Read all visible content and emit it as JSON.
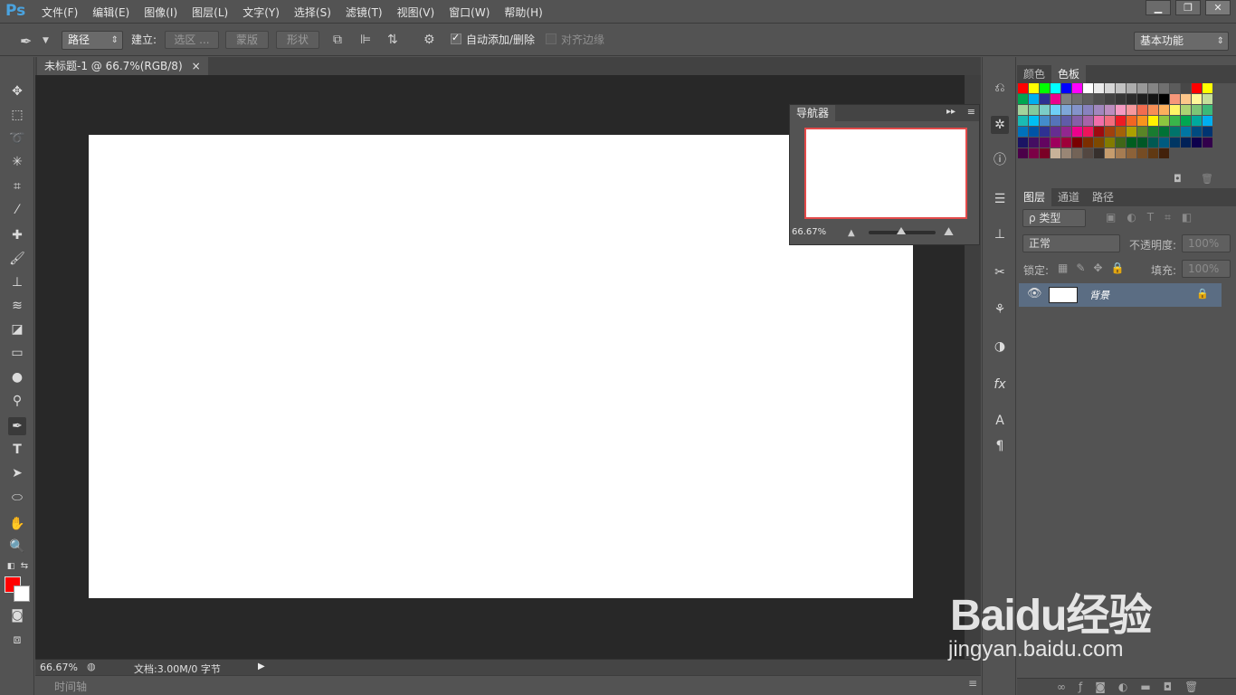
{
  "app": {
    "logo": "Ps"
  },
  "menu": [
    "文件(F)",
    "编辑(E)",
    "图像(I)",
    "图层(L)",
    "文字(Y)",
    "选择(S)",
    "滤镜(T)",
    "视图(V)",
    "窗口(W)",
    "帮助(H)"
  ],
  "window_controls": {
    "minimize": "▁",
    "restore": "❐",
    "close": "✕"
  },
  "options": {
    "mode_select": "路径",
    "make_label": "建立:",
    "selection_btn": "选区 ...",
    "mask_btn": "蒙版",
    "shape_btn": "形状",
    "auto_add_delete": "自动添加/删除",
    "align_edges": "对齐边缘",
    "workspace": "基本功能"
  },
  "document": {
    "tab_title": "未标题-1 @ 66.7%(RGB/8)",
    "tab_close": "×"
  },
  "navigator": {
    "tab": "导航器",
    "zoom": "66.67%"
  },
  "swatch_panel": {
    "tabs": [
      "颜色",
      "色板"
    ]
  },
  "swatch_colors": [
    "#ff0000",
    "#ffff00",
    "#00ff00",
    "#00ffff",
    "#0000ff",
    "#ff00ff",
    "#ffffff",
    "#ebebeb",
    "#d6d6d6",
    "#c2c2c2",
    "#adadad",
    "#999999",
    "#858585",
    "#707070",
    "#5c5c5c",
    "#474747",
    "#ff0000",
    "#ffff00",
    "#00a651",
    "#00aeef",
    "#2e3192",
    "#ec008c",
    "#808080",
    "#6e6e6e",
    "#5e5e5e",
    "#4f4f4f",
    "#424242",
    "#363636",
    "#2b2b2b",
    "#1f1f1f",
    "#141414",
    "#000000",
    "#f7977a",
    "#fdc68a",
    "#fff79a",
    "#c4df9b",
    "#a3d39c",
    "#82ca9d",
    "#7bcdc8",
    "#6ecff6",
    "#7ea7d8",
    "#8493ca",
    "#8882be",
    "#a187be",
    "#bc8dbf",
    "#f49ac2",
    "#f6989d",
    "#f26c4f",
    "#f68e55",
    "#fbaf5c",
    "#fff467",
    "#acd373",
    "#7cc576",
    "#3bb878",
    "#1abbb4",
    "#00bff3",
    "#438ccb",
    "#5574b9",
    "#605ca8",
    "#855fa8",
    "#a763a8",
    "#f06ea9",
    "#f26d7d",
    "#ed1c24",
    "#f26522",
    "#f7941d",
    "#fff200",
    "#8dc63f",
    "#39b54a",
    "#00a651",
    "#00a99d",
    "#00aeef",
    "#0072bc",
    "#0054a6",
    "#2e3192",
    "#662d91",
    "#92278f",
    "#ec008c",
    "#ed145b",
    "#9e0b0f",
    "#a0410d",
    "#a36209",
    "#aba000",
    "#598527",
    "#197b30",
    "#007236",
    "#00746b",
    "#0076a3",
    "#004b80",
    "#003471",
    "#1b1464",
    "#440e62",
    "#630460",
    "#9e005d",
    "#9e0039",
    "#790000",
    "#7b2e00",
    "#7d4900",
    "#827b00",
    "#406618",
    "#005e20",
    "#005826",
    "#005952",
    "#005b7f",
    "#003663",
    "#002157",
    "#0d004c",
    "#32004b",
    "#4b0049",
    "#7b0046",
    "#7a0026",
    "#c7b299",
    "#998675",
    "#736357",
    "#534741",
    "#37302d",
    "#c69c6d",
    "#a67c52",
    "#8c6239",
    "#754c24",
    "#603913",
    "#42210b"
  ],
  "layers_panel": {
    "tabs": [
      "图层",
      "通道",
      "路径"
    ],
    "filter_kind": "ρ 类型",
    "blend_mode": "正常",
    "opacity_label": "不透明度:",
    "opacity_value": "100%",
    "lock_label": "锁定:",
    "fill_label": "填充:",
    "fill_value": "100%",
    "layer_name": "背景"
  },
  "status": {
    "zoom": "66.67%",
    "doc_info": "文档:3.00M/0 字节"
  },
  "timeline": {
    "label": "时间轴"
  },
  "watermark": {
    "logo": "Baidu经验",
    "url": "jingyan.baidu.com"
  }
}
